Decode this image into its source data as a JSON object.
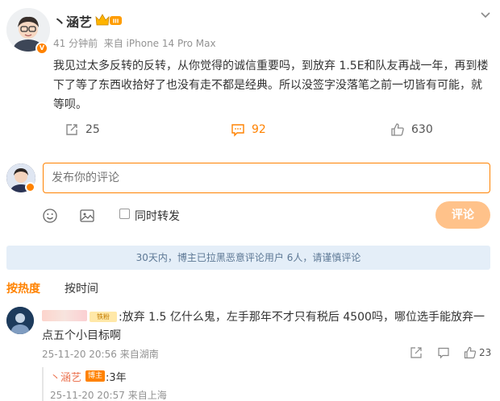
{
  "post": {
    "author": "丶涵艺",
    "time": "41 分钟前",
    "source": "来自 iPhone 14 Pro Max",
    "level_badge": "III",
    "content": "我见过太多反转的反转，从你觉得的诚信重要吗，到放弃 1.5E和队友再战一年，再到楼下了等了东西收拾好了也没有走不都是经典。所以没签字没落笔之前一切皆有可能，就等呗。",
    "reposts": "25",
    "comments": "92",
    "likes": "630"
  },
  "composer": {
    "placeholder": "发布你的评论",
    "repost_label": "同时转发",
    "submit_label": "评论"
  },
  "notice": "30天内，博主已拉黑恶意评论用户 6人，请谨慎评论",
  "sort": {
    "hot": "按热度",
    "time": "按时间"
  },
  "comments_list": [
    {
      "fan_badge": "铁粉",
      "text": ":放弃 1.5 亿什么鬼，左手那年不才只有税后 4500吗，哪位选手能放弃一点五个小目标啊",
      "time": "25-11-20 20:56",
      "location": "来自湖南",
      "likes": "23",
      "reply": {
        "author": "丶涵艺",
        "tag": "博主",
        "text": ":3年",
        "time": "25-11-20 20:57",
        "location": "来自上海"
      }
    }
  ],
  "colors": {
    "accent": "#ff8200",
    "notice_bg": "#e4eef8",
    "notice_text": "#5d7895",
    "reply_name": "#eb7350"
  },
  "icons": {
    "repost": "repost-icon",
    "comment": "comment-icon",
    "like": "thumbs-up-icon",
    "emoji": "emoji-icon",
    "image": "image-icon",
    "more": "chevron-down-icon"
  }
}
